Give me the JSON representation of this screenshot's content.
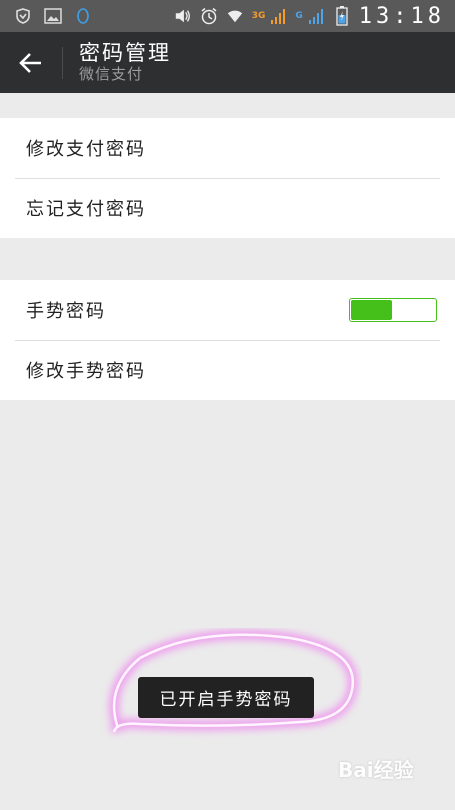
{
  "status_bar": {
    "time": "13:18",
    "net1": "3G",
    "net2": "G",
    "icons": [
      "shield-icon",
      "image-icon",
      "circle-icon",
      "volume-icon",
      "alarm-icon",
      "wifi-icon",
      "signal-icon",
      "signal-icon",
      "battery-icon"
    ]
  },
  "header": {
    "title": "密码管理",
    "subtitle": "微信支付"
  },
  "payment_password": {
    "change": "修改支付密码",
    "forgot": "忘记支付密码"
  },
  "gesture_password": {
    "label": "手势密码",
    "enabled": true,
    "change": "修改手势密码"
  },
  "toast": {
    "message": "已开启手势密码"
  },
  "watermark": "Bai经验",
  "colors": {
    "accent": "#45c01a",
    "titlebar": "#2d2f30",
    "statusbar": "#595959",
    "highlight": "#e040e0"
  }
}
